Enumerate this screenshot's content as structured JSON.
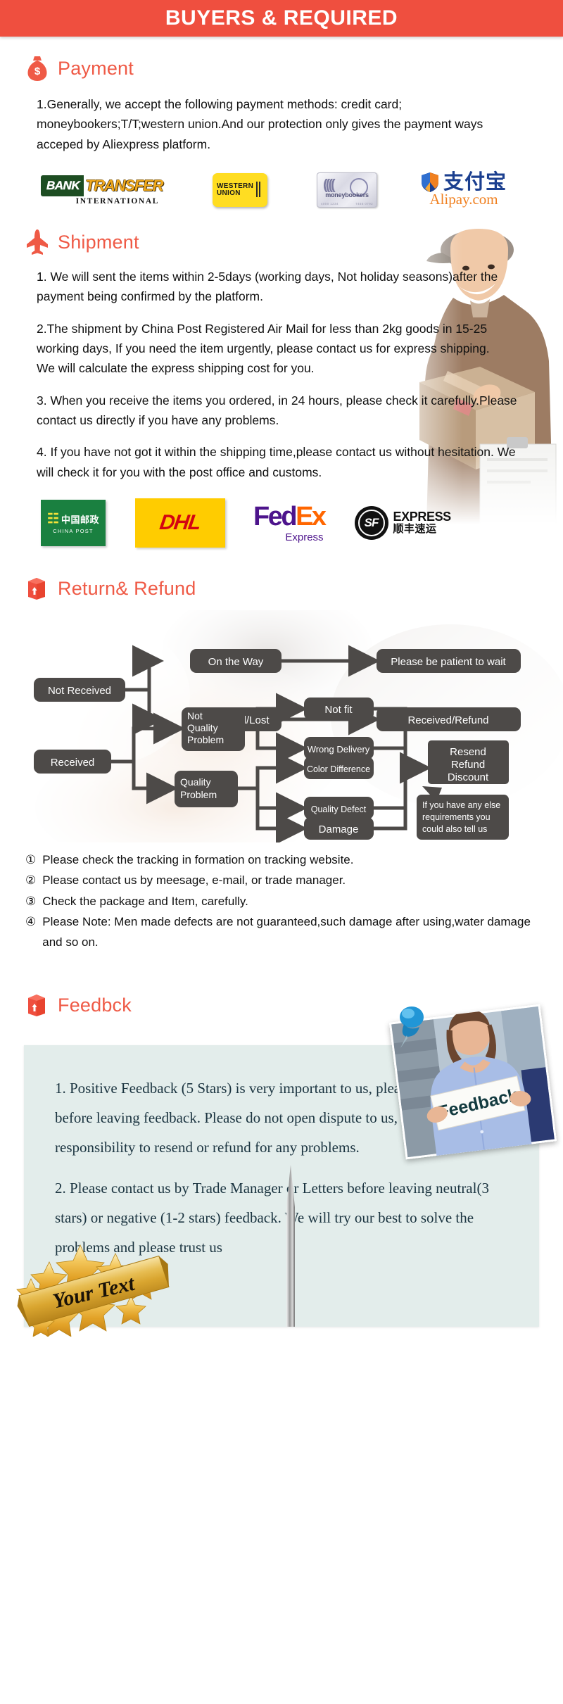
{
  "banner": {
    "title": "BUYERS & REQUIRED",
    "bg_color": "#ef4f3f",
    "text_color": "#ffffff"
  },
  "theme": {
    "accent": "#ef5a46",
    "heading_color": "#ef5a46",
    "feedback_card_bg": "#e3edeb",
    "flow_box_bg": "#4d4a48"
  },
  "payment": {
    "heading": "Payment",
    "icon": "money-bag-icon",
    "paragraphs": [
      "1.Generally, we accept the following payment methods: credit card; moneybookers;T/T;western union.And our protection only gives the payment ways acceped by Aliexpress platform."
    ],
    "logos": [
      {
        "name": "bank-transfer-logo",
        "line1_left": "BANK",
        "line1_right": "TRANSFER",
        "line2": "INTERNATIONAL"
      },
      {
        "name": "western-union-logo",
        "line1": "WESTERN",
        "line2": "UNION"
      },
      {
        "name": "moneybookers-logo",
        "label": "moneybookers",
        "tiny_left": "4000 1234",
        "tiny_right": "7465 0792"
      },
      {
        "name": "alipay-logo",
        "hanzi": "支付宝",
        "latin": "Alipay.com"
      }
    ]
  },
  "shipment": {
    "heading": "Shipment",
    "icon": "airplane-icon",
    "paragraphs": [
      "1. We will sent the items within 2-5days (working days, Not holiday seasons)after the payment being confirmed by the platform.",
      "2.The shipment by China Post Registered Air Mail for less than  2kg goods in 15-25 working days, If  you need the item urgently, please contact us for express shipping.\nWe will calculate the express shipping cost for you.",
      "3. When you receive the items you ordered, in 24 hours, please check  it carefully.Please contact us directly if you have any problems.",
      "4. If you have not got it within the shipping time,please contact us without hesitation. We will check it for you with the post office and customs."
    ],
    "carriers": [
      {
        "name": "china-post-logo",
        "hanzi": "中国邮政",
        "latin": "CHINA POST"
      },
      {
        "name": "dhl-logo",
        "label": "DHL"
      },
      {
        "name": "fedex-logo",
        "fed": "Fed",
        "ex": "Ex",
        "sub": "Express"
      },
      {
        "name": "sf-express-logo",
        "mark": "SF",
        "en": "EXPRESS",
        "cn": "顺丰速运"
      }
    ]
  },
  "returns": {
    "heading": "Return& Refund",
    "icon": "return-box-icon",
    "flow": {
      "nodes": [
        {
          "id": "not-received",
          "label": "Not Received"
        },
        {
          "id": "on-the-way",
          "label": "On the Way"
        },
        {
          "id": "please-be-patient",
          "label": "Please be patient to wait"
        },
        {
          "id": "received-lost",
          "label": "Received/Lost"
        },
        {
          "id": "received-refund",
          "label": "Received/Refund"
        },
        {
          "id": "received",
          "label": "Received"
        },
        {
          "id": "not-quality-problem",
          "label": "Not\nQuality\nProblem"
        },
        {
          "id": "quality-problem",
          "label": "Quality\nProblem"
        },
        {
          "id": "not-fit",
          "label": "Not fit"
        },
        {
          "id": "wrong-delivery",
          "label": "Wrong Delivery"
        },
        {
          "id": "color-difference",
          "label": "Color Difference"
        },
        {
          "id": "quality-defect",
          "label": "Quality Defect"
        },
        {
          "id": "damage",
          "label": "Damage"
        },
        {
          "id": "resend-refund-discount",
          "label": "Resend\nRefund\nDiscount"
        },
        {
          "id": "any-else-requirements",
          "label": "If you have any else\nrequirements you\ncould also tell us"
        }
      ]
    },
    "notes": [
      {
        "marker": "①",
        "text": "Please check the tracking in formation on tracking website."
      },
      {
        "marker": "②",
        "text": "Please contact us by meesage, e-mail, or trade manager."
      },
      {
        "marker": "③",
        "text": "Check the package and Item, carefully."
      },
      {
        "marker": "④",
        "text": "Please Note: Men made defects  are not guaranteed,such damage after using,water damage and so on."
      }
    ]
  },
  "feedback": {
    "heading": "Feedbck",
    "icon": "return-box-icon",
    "photo_sign_text": "Feedback",
    "paragraphs": [
      "1. Positive Feedback (5 Stars) is very important to us, please think twice before leaving feedback. Please do not open dispute to us,   we will take responsibility to resend or refund for any problems.",
      "2. Please contact us by Trade Manager or Letters before leaving neutral(3 stars) or negative (1-2 stars) feedback. We will try our best to solve the problems and please trust us"
    ],
    "badge_text": "Your Text"
  }
}
